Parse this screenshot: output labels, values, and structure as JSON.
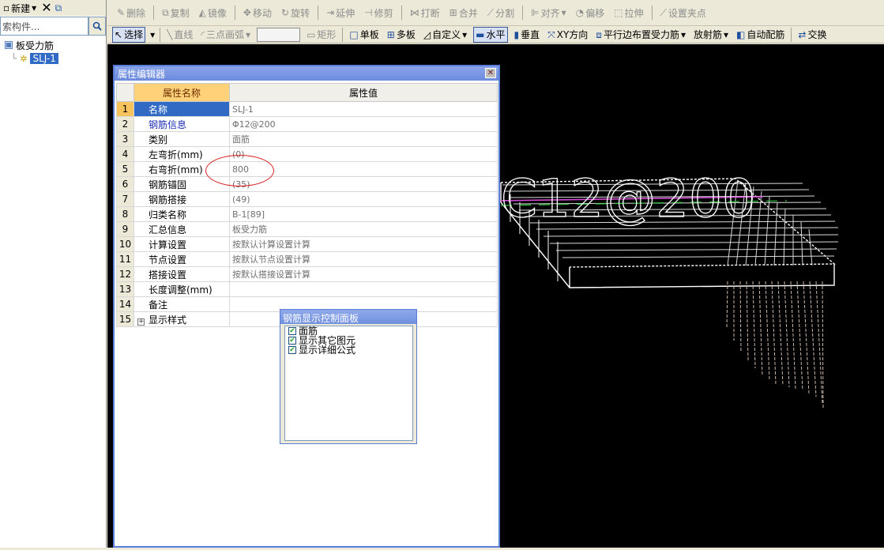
{
  "left_panel": {
    "new_label": "新建",
    "search_placeholder": "索构件...",
    "tree_root": "板受力筋",
    "tree_child": "SLJ-1"
  },
  "toolbar1": {
    "delete": "删除",
    "copy": "复制",
    "mirror": "镜像",
    "move": "移动",
    "rotate": "旋转",
    "extend": "延伸",
    "trim": "修剪",
    "break": "打断",
    "merge": "合并",
    "split": "分割",
    "align": "对齐",
    "offset": "偏移",
    "stretch": "拉伸",
    "set_grip": "设置夹点"
  },
  "toolbar2": {
    "select": "选择",
    "line": "直线",
    "arc3": "三点画弧",
    "rect": "矩形",
    "single_slab": "单板",
    "multi_slab": "多板",
    "custom": "自定义",
    "horizontal": "水平",
    "vertical": "垂直",
    "xy_dir": "XY方向",
    "parallel_edge": "平行边布置受力筋",
    "radial": "放射筋",
    "auto_rebar": "自动配筋",
    "swap": "交换"
  },
  "canvas": {
    "rebar_label": "C12@200"
  },
  "prop_editor": {
    "title": "属性编辑器",
    "col_name": "属性名称",
    "col_value": "属性值",
    "rows": [
      {
        "idx": "1",
        "name": "名称",
        "value": "SLJ-1"
      },
      {
        "idx": "2",
        "name": "钢筋信息",
        "value": "Φ12@200"
      },
      {
        "idx": "3",
        "name": "类别",
        "value": "面筋"
      },
      {
        "idx": "4",
        "name": "左弯折(mm)",
        "value": "(0)"
      },
      {
        "idx": "5",
        "name": "右弯折(mm)",
        "value": "800"
      },
      {
        "idx": "6",
        "name": "钢筋锚固",
        "value": "(35)"
      },
      {
        "idx": "7",
        "name": "钢筋搭接",
        "value": "(49)"
      },
      {
        "idx": "8",
        "name": "归类名称",
        "value": "B-1[89]"
      },
      {
        "idx": "9",
        "name": "汇总信息",
        "value": "板受力筋"
      },
      {
        "idx": "10",
        "name": "计算设置",
        "value": "按默认计算设置计算"
      },
      {
        "idx": "11",
        "name": "节点设置",
        "value": "按默认节点设置计算"
      },
      {
        "idx": "12",
        "name": "搭接设置",
        "value": "按默认搭接设置计算"
      },
      {
        "idx": "13",
        "name": "长度调整(mm)",
        "value": ""
      },
      {
        "idx": "14",
        "name": "备注",
        "value": ""
      },
      {
        "idx": "15",
        "name": "显示样式",
        "value": ""
      }
    ]
  },
  "rebar_panel": {
    "title": "钢筋显示控制面板",
    "options": [
      "面筋",
      "显示其它图元",
      "显示详细公式"
    ]
  }
}
